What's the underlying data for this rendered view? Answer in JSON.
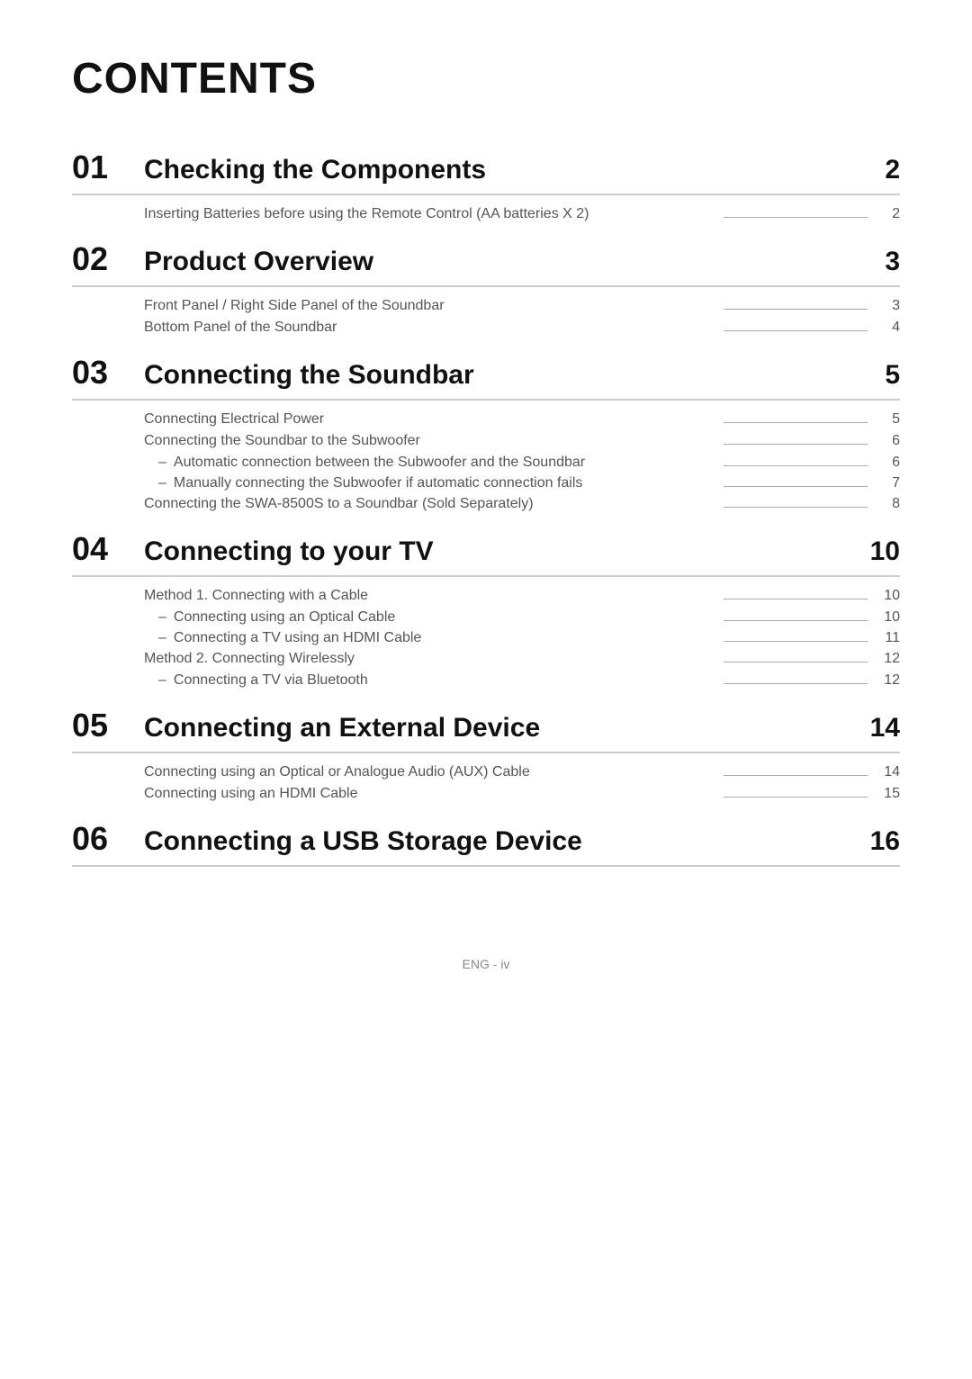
{
  "page": {
    "title": "CONTENTS",
    "footer": "ENG - iv"
  },
  "sections": [
    {
      "number": "01",
      "title": "Checking the Components",
      "page": "2",
      "entries": [
        {
          "text": "Inserting Batteries before using the Remote Control (AA batteries X 2)",
          "page": "2",
          "sub_entries": []
        }
      ]
    },
    {
      "number": "02",
      "title": "Product Overview",
      "page": "3",
      "entries": [
        {
          "text": "Front Panel / Right Side Panel of the Soundbar",
          "page": "3",
          "sub_entries": []
        },
        {
          "text": "Bottom Panel of the Soundbar",
          "page": "4",
          "sub_entries": []
        }
      ]
    },
    {
      "number": "03",
      "title": "Connecting the Soundbar",
      "page": "5",
      "entries": [
        {
          "text": "Connecting Electrical Power",
          "page": "5",
          "sub_entries": []
        },
        {
          "text": "Connecting the Soundbar to the Subwoofer",
          "page": "6",
          "sub_entries": [
            {
              "text": "Automatic connection between the Subwoofer and the Soundbar",
              "page": "6"
            },
            {
              "text": "Manually connecting the Subwoofer if automatic connection fails",
              "page": "7"
            }
          ]
        },
        {
          "text": "Connecting the SWA-8500S to a Soundbar (Sold Separately)",
          "page": "8",
          "sub_entries": []
        }
      ]
    },
    {
      "number": "04",
      "title": "Connecting to your TV",
      "page": "10",
      "entries": [
        {
          "text": "Method 1. Connecting with a Cable",
          "page": "10",
          "sub_entries": [
            {
              "text": "Connecting using an Optical Cable",
              "page": "10"
            },
            {
              "text": "Connecting a TV using an HDMI Cable",
              "page": "11"
            }
          ]
        },
        {
          "text": "Method 2. Connecting Wirelessly",
          "page": "12",
          "sub_entries": [
            {
              "text": "Connecting a TV via Bluetooth",
              "page": "12"
            }
          ]
        }
      ]
    },
    {
      "number": "05",
      "title": "Connecting an External Device",
      "page": "14",
      "entries": [
        {
          "text": "Connecting using an Optical or Analogue Audio (AUX) Cable",
          "page": "14",
          "sub_entries": []
        },
        {
          "text": "Connecting using an HDMI Cable",
          "page": "15",
          "sub_entries": []
        }
      ]
    },
    {
      "number": "06",
      "title": "Connecting a USB Storage Device",
      "page": "16",
      "entries": []
    }
  ]
}
